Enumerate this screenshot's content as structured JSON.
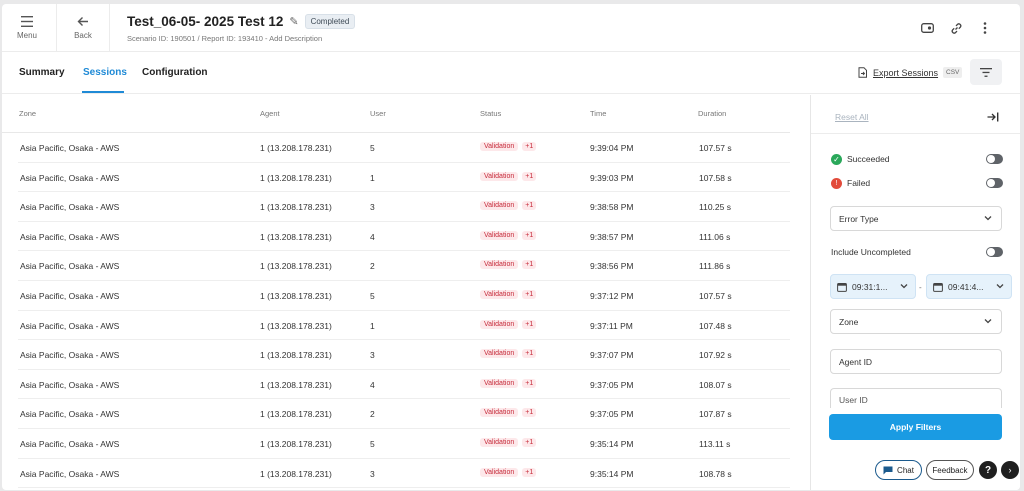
{
  "header": {
    "menu_label": "Menu",
    "back_label": "Back",
    "title": "Test_06-05- 2025 Test 12",
    "status_badge": "Completed",
    "subtitle": "Scenario ID: 190501 / Report ID: 193410 - Add Description",
    "icons": [
      "menu-icon",
      "back-arrow-icon",
      "pencil-icon",
      "toggle-view-icon",
      "link-icon",
      "more-vert-icon"
    ]
  },
  "tabs": {
    "items": [
      {
        "label": "Summary"
      },
      {
        "label": "Sessions"
      },
      {
        "label": "Configuration"
      }
    ],
    "active": "Sessions",
    "export_label": "Export Sessions",
    "csv_label": "CSV"
  },
  "table": {
    "columns": [
      "Zone",
      "Agent",
      "User",
      "Status",
      "Time",
      "Duration"
    ],
    "rows": [
      {
        "zone": "Asia Pacific, Osaka - AWS",
        "agent": "1 (13.208.178.231)",
        "user": "5",
        "status": "Validation",
        "count": "+1",
        "time": "9:39:04 PM",
        "duration": "107.57 s"
      },
      {
        "zone": "Asia Pacific, Osaka - AWS",
        "agent": "1 (13.208.178.231)",
        "user": "1",
        "status": "Validation",
        "count": "+1",
        "time": "9:39:03 PM",
        "duration": "107.58 s"
      },
      {
        "zone": "Asia Pacific, Osaka - AWS",
        "agent": "1 (13.208.178.231)",
        "user": "3",
        "status": "Validation",
        "count": "+1",
        "time": "9:38:58 PM",
        "duration": "110.25 s"
      },
      {
        "zone": "Asia Pacific, Osaka - AWS",
        "agent": "1 (13.208.178.231)",
        "user": "4",
        "status": "Validation",
        "count": "+1",
        "time": "9:38:57 PM",
        "duration": "111.06 s"
      },
      {
        "zone": "Asia Pacific, Osaka - AWS",
        "agent": "1 (13.208.178.231)",
        "user": "2",
        "status": "Validation",
        "count": "+1",
        "time": "9:38:56 PM",
        "duration": "111.86 s"
      },
      {
        "zone": "Asia Pacific, Osaka - AWS",
        "agent": "1 (13.208.178.231)",
        "user": "5",
        "status": "Validation",
        "count": "+1",
        "time": "9:37:12 PM",
        "duration": "107.57 s"
      },
      {
        "zone": "Asia Pacific, Osaka - AWS",
        "agent": "1 (13.208.178.231)",
        "user": "1",
        "status": "Validation",
        "count": "+1",
        "time": "9:37:11 PM",
        "duration": "107.48 s"
      },
      {
        "zone": "Asia Pacific, Osaka - AWS",
        "agent": "1 (13.208.178.231)",
        "user": "3",
        "status": "Validation",
        "count": "+1",
        "time": "9:37:07 PM",
        "duration": "107.92 s"
      },
      {
        "zone": "Asia Pacific, Osaka - AWS",
        "agent": "1 (13.208.178.231)",
        "user": "4",
        "status": "Validation",
        "count": "+1",
        "time": "9:37:05 PM",
        "duration": "108.07 s"
      },
      {
        "zone": "Asia Pacific, Osaka - AWS",
        "agent": "1 (13.208.178.231)",
        "user": "2",
        "status": "Validation",
        "count": "+1",
        "time": "9:37:05 PM",
        "duration": "107.87 s"
      },
      {
        "zone": "Asia Pacific, Osaka - AWS",
        "agent": "1 (13.208.178.231)",
        "user": "5",
        "status": "Validation",
        "count": "+1",
        "time": "9:35:14 PM",
        "duration": "113.11 s"
      },
      {
        "zone": "Asia Pacific, Osaka - AWS",
        "agent": "1 (13.208.178.231)",
        "user": "3",
        "status": "Validation",
        "count": "+1",
        "time": "9:35:14 PM",
        "duration": "108.78 s"
      }
    ]
  },
  "filters": {
    "reset_label": "Reset All",
    "succeeded_label": "Succeeded",
    "failed_label": "Failed",
    "error_type_label": "Error Type",
    "include_uncompleted_label": "Include Uncompleted",
    "time_from": "09:31:1...",
    "time_to": "09:41:4...",
    "time_separator": "-",
    "zone_label": "Zone",
    "agent_id_label": "Agent ID",
    "user_id_label": "User ID",
    "apply_label": "Apply Filters",
    "toggles": {
      "succeeded": false,
      "failed": false,
      "include_uncompleted": false
    }
  },
  "support": {
    "chat_label": "Chat",
    "feedback_label": "Feedback",
    "help_label": "?",
    "next_label": "›"
  },
  "colors": {
    "accent": "#1f8ad6",
    "apply_button": "#1a9be3",
    "error_badge_text": "#c62b3a",
    "error_badge_bg": "#fde8ea",
    "success": "#2aa85a",
    "failure": "#e24b3b"
  }
}
